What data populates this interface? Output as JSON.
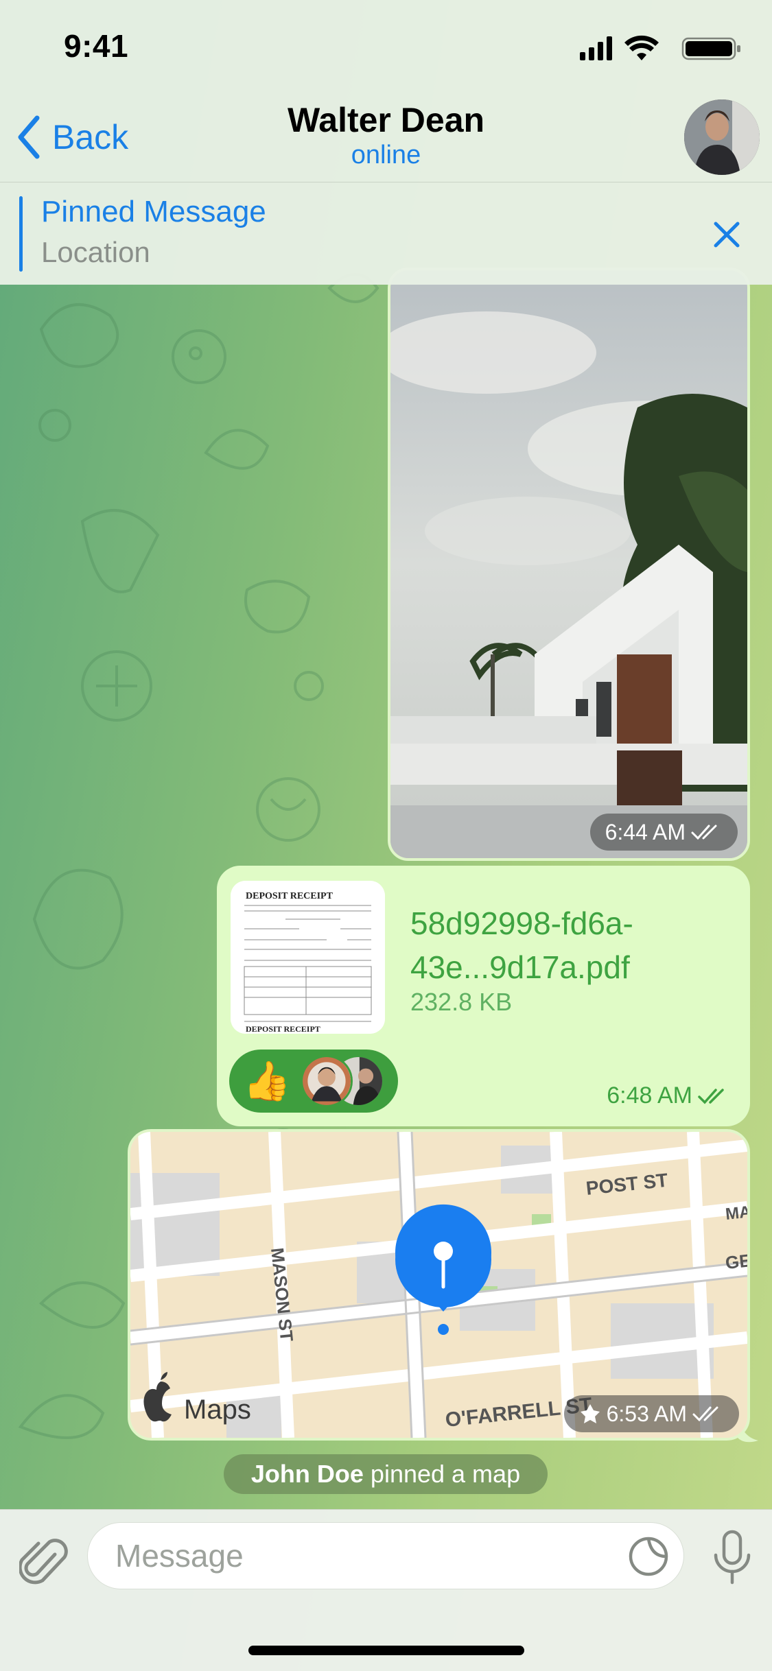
{
  "status_bar": {
    "time": "9:41"
  },
  "header": {
    "back_label": "Back",
    "contact_name": "Walter Dean",
    "contact_status": "online"
  },
  "pinned": {
    "title": "Pinned Message",
    "subtitle": "Location"
  },
  "messages": {
    "photo": {
      "time": "6:44 AM"
    },
    "file": {
      "name": "58d92998-fd6a-43e...9d17a.pdf",
      "size": "232.8 KB",
      "time": "6:48 AM",
      "reaction": "👍",
      "thumb_title": "DEPOSIT RECEIPT"
    },
    "map": {
      "time": "6:53 AM",
      "brand": "Maps",
      "streets": [
        "POST ST",
        "MASON ST",
        "O'FARRELL ST",
        "MA",
        "GE"
      ]
    }
  },
  "service": {
    "actor": "John Doe",
    "action": "pinned a map"
  },
  "composer": {
    "placeholder": "Message"
  },
  "colors": {
    "accent": "#1a80e6",
    "outgoing_bubble": "#e0fbc6",
    "outgoing_text": "#3ea341"
  }
}
